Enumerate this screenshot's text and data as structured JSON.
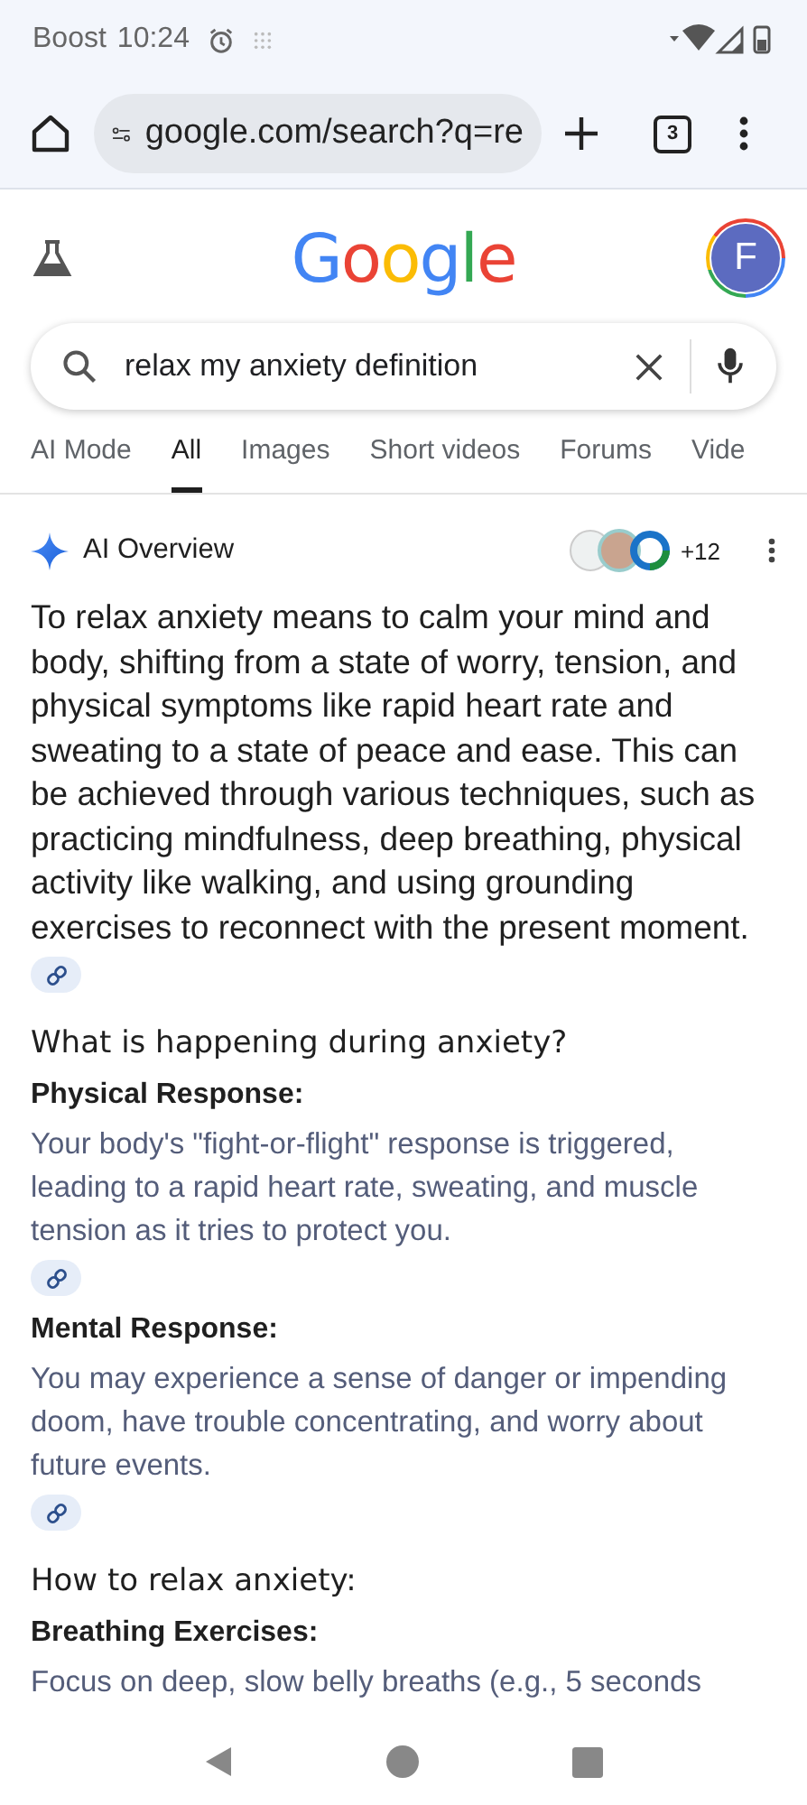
{
  "status_bar": {
    "carrier": "Boost",
    "time": "10:24"
  },
  "browser": {
    "url": "google.com/search?q=re",
    "tab_count": "3"
  },
  "header": {
    "logo": "Google",
    "avatar_letter": "F"
  },
  "search": {
    "value": "relax my anxiety definition"
  },
  "tabs": [
    {
      "label": "AI Mode",
      "selected": false
    },
    {
      "label": "All",
      "selected": true
    },
    {
      "label": "Images",
      "selected": false
    },
    {
      "label": "Short videos",
      "selected": false
    },
    {
      "label": "Forums",
      "selected": false
    },
    {
      "label": "Vide",
      "selected": false
    }
  ],
  "ai_overview": {
    "title": "AI Overview",
    "source_count": "+12",
    "summary": "To relax anxiety means to calm your mind and body, shifting from a state of worry, tension, and physical symptoms like rapid heart rate and sweating to a state of peace and ease. This can be achieved through various techniques, such as practicing mindfulness, deep breathing, physical activity like walking, and using grounding exercises to reconnect with the present moment.",
    "sections": [
      {
        "heading": "What is happening during anxiety?",
        "items": [
          {
            "title": "Physical Response:",
            "text": "Your body's \"fight-or-flight\" response is triggered, leading to a rapid heart rate, sweating, and muscle tension as it tries to protect you.",
            "link": true
          },
          {
            "title": "Mental Response:",
            "text": "You may experience a sense of danger or impending doom, have trouble concentrating, and worry about future events.",
            "link": true
          }
        ]
      },
      {
        "heading": "How to relax anxiety:",
        "items": [
          {
            "title": "Breathing Exercises:",
            "text": "Focus on deep, slow belly breaths (e.g., 5 seconds",
            "link": false
          }
        ]
      }
    ]
  }
}
